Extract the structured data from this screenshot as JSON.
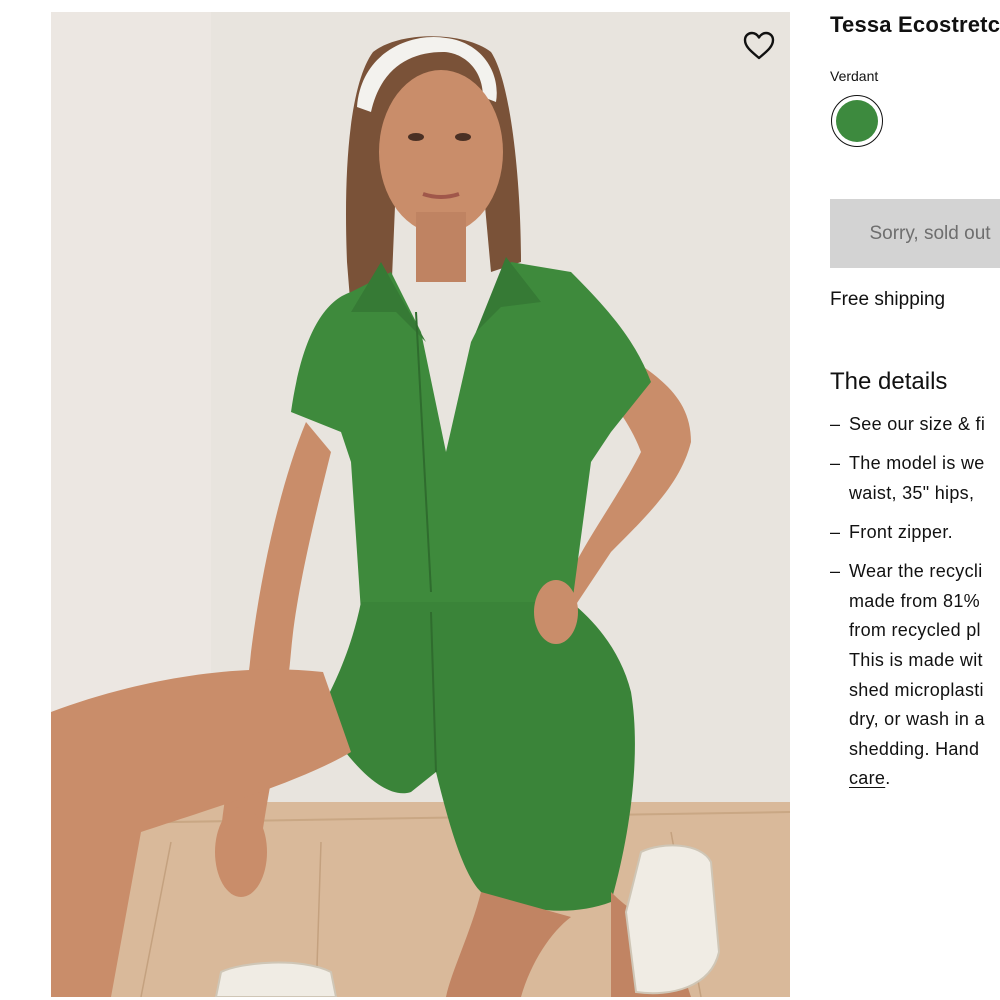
{
  "product": {
    "title": "Tessa Ecostretch",
    "image_alt": "Model wearing a green short-sleeve zip-front romper",
    "favorite_icon": "heart-icon"
  },
  "color": {
    "label": "Verdant",
    "swatch_hex": "#3d8a3e"
  },
  "cta": {
    "label": "Sorry, sold out"
  },
  "shipping": {
    "text": "Free shipping"
  },
  "details": {
    "title": "The details",
    "items": [
      {
        "lines": [
          "See our size & fi"
        ]
      },
      {
        "lines": [
          "The model is we",
          "waist, 35\" hips,"
        ]
      },
      {
        "lines": [
          "Front zipper."
        ]
      },
      {
        "lines": [
          "Wear the recycli",
          "made from 81%",
          "from recycled pl",
          "This is made wit",
          "shed microplasti",
          "dry, or wash in a",
          "shedding. Hand"
        ],
        "link": "care",
        "after_link": "."
      }
    ],
    "dash": "–"
  },
  "colors": {
    "garment_green": "#3e8a3c",
    "button_gray": "#d3d3d3",
    "text": "#111111"
  }
}
